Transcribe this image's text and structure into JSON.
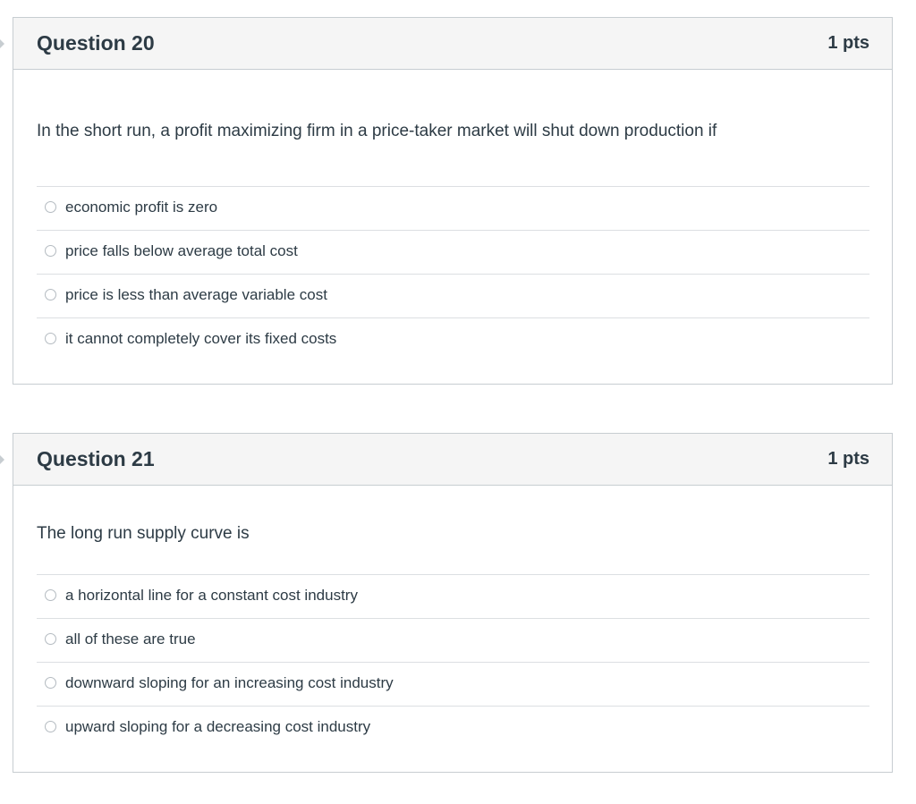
{
  "questions": [
    {
      "title": "Question 20",
      "points": "1 pts",
      "text": "In the short run, a profit maximizing firm in a price-taker market will shut down production if",
      "answers": [
        "economic profit is zero",
        "price falls below average total cost",
        "price is less than average variable cost",
        "it cannot completely cover its fixed costs"
      ]
    },
    {
      "title": "Question 21",
      "points": "1 pts",
      "text": "The long run supply curve is",
      "answers": [
        "a horizontal line for a constant cost industry",
        "all of these are true",
        "downward sloping for an increasing cost industry",
        "upward sloping for a decreasing cost industry"
      ]
    }
  ]
}
